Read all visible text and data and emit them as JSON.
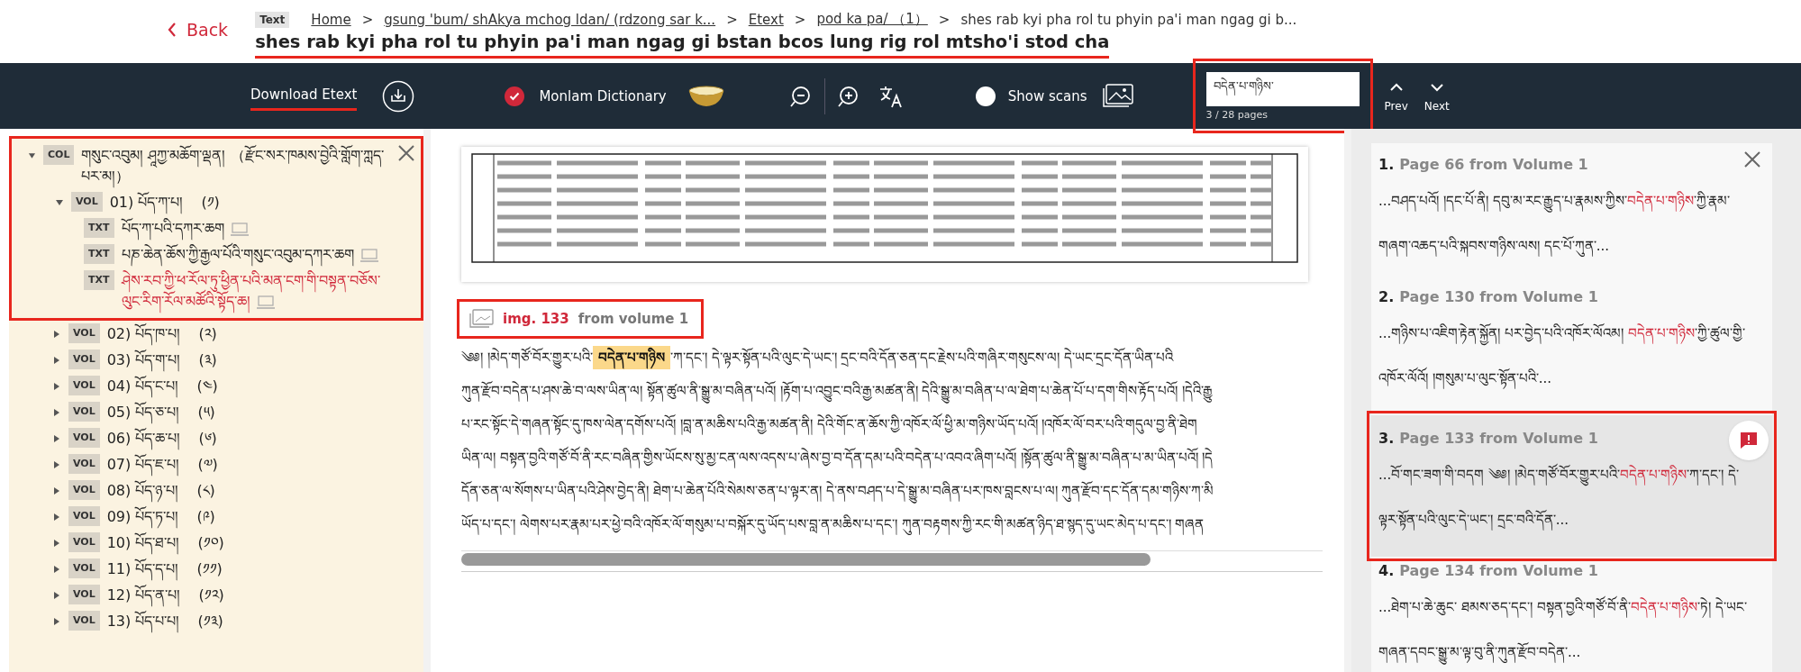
{
  "header": {
    "back": "Back",
    "type_badge": "Text",
    "breadcrumbs": [
      {
        "label": "Home",
        "link": true
      },
      {
        "separator": ">",
        "label": "gsung 'bum/ shAkya mchog ldan/ (rdzong sar k...",
        "link": true
      },
      {
        "separator": ">",
        "label": "Etext",
        "link": true
      },
      {
        "separator": ">",
        "label": "pod ka pa/ （1）",
        "link": true
      },
      {
        "separator": ">",
        "label": "shes rab kyi pha rol tu phyin pa'i man ngag gi b...",
        "link": false
      }
    ],
    "title": "shes rab kyi pha rol tu phyin pa'i man ngag gi bstan bcos lung rig rol mtsho'i stod cha",
    "highlighted": true
  },
  "toolbar": {
    "download": {
      "label": "Download Etext",
      "highlighted": true
    },
    "dictionary": {
      "label": "Monlam Dictionary",
      "checked": true
    },
    "scans": {
      "label": "Show scans",
      "on": false
    },
    "search": {
      "value": "བདེན་པ་གཉིས་",
      "count": "3 / 28 pages",
      "highlighted": true
    },
    "prev": "Prev",
    "next": "Next"
  },
  "tree": {
    "tag": "COL",
    "label": "གསུང་འབུམ། ཤཱཀྱ་མཆོག་ལྡན། （རྫོང་སར་ཁམས་བྱེའི་གློག་ཀླད་པར་མ།）",
    "expanded": true,
    "highlighted": true,
    "children": [
      {
        "tag": "VOL",
        "label": "01) པོད་ཀ་པ།",
        "number": "(༡)",
        "expanded": true,
        "children": [
          {
            "tag": "TXT",
            "label": "པོད་ཀ་པའི་དཀར་ཆག",
            "selected": false
          },
          {
            "tag": "TXT",
            "label": "པཎ་ཆེན་ཆོས་ཀྱི་རྒྱལ་པོའི་གསུང་འབུམ་དཀར་ཆག",
            "selected": false
          },
          {
            "tag": "TXT",
            "label": "ཤེས་རབ་ཀྱི་ཕ་རོལ་ཏུ་ཕྱིན་པའི་མན་ངག་གི་བསྟན་བཅོས་ལུང་རིག་རོལ་མཚོའི་སྟོད་ཆ།",
            "selected": true
          }
        ]
      },
      {
        "tag": "VOL",
        "label": "02) པོད་ཁ་པ།",
        "number": "(༢)",
        "expanded": false
      },
      {
        "tag": "VOL",
        "label": "03) པོད་ག་པ།",
        "number": "(༣)",
        "expanded": false
      },
      {
        "tag": "VOL",
        "label": "04) པོད་ང་པ།",
        "number": "(༤)",
        "expanded": false
      },
      {
        "tag": "VOL",
        "label": "05) པོད་ཅ་པ།",
        "number": "(༥)",
        "expanded": false
      },
      {
        "tag": "VOL",
        "label": "06) པོད་ཆ་པ།",
        "number": "(༦)",
        "expanded": false
      },
      {
        "tag": "VOL",
        "label": "07) པོད་ཇ་པ།",
        "number": "(༧)",
        "expanded": false
      },
      {
        "tag": "VOL",
        "label": "08) པོད་ཉ་པ།",
        "number": "(༨)",
        "expanded": false
      },
      {
        "tag": "VOL",
        "label": "09) པོད་ཏ་པ།",
        "number": "(༩)",
        "expanded": false
      },
      {
        "tag": "VOL",
        "label": "10) པོད་ཐ་པ།",
        "number": "(༡༠)",
        "expanded": false
      },
      {
        "tag": "VOL",
        "label": "11) པོད་ད་པ།",
        "number": "(༡༡)",
        "expanded": false
      },
      {
        "tag": "VOL",
        "label": "12) པོད་ན་པ།",
        "number": "(༡༢)",
        "expanded": false
      },
      {
        "tag": "VOL",
        "label": "13) པོད་པ་པ།",
        "number": "(༡༣)",
        "expanded": false
      }
    ]
  },
  "reader": {
    "caption": {
      "image": "img. 133",
      "volume": "from volume 1",
      "highlighted": true
    },
    "lines": [
      {
        "before": "༄༅། །མེད་གཙོ་བོར་གྱུར་པའི་",
        "match": "བདེན་པ་གཉིས",
        "after": "་ཀ་དང་། དེ་ལྟར་སྟོན་པའི་ལུང་དེ་ཡང་། དྲང་བའི་དོན་ཅན་དང་རྗེས་པའི་གཞིར་གསུངས་ལ། དེ་ཡང་དྲང་དོན་ཡིན་པའི"
      },
      {
        "before": "ཀུན་རྫོབ་བདེན་པ་ཤས་ཆེ་བ་ལས་ཡིན་ལ། སྟོན་ཚུལ་ནི་སྒྱུ་མ་བཞིན་པའོ། །རྟོག་པ་འབྱུང་བའི་རྒྱ་མཚན་ནི། དེའི་སྒྱུ་མ་བཞིན་པ་ལ་ཐེག་པ་ཆེན་པོ་པ་དག་གིས་རྟོད་པའོ། །དེའི་རྒྱུ"
      },
      {
        "before": "པ་རང་སྟོང་དེ་གཞན་སྟོང་དུ་ཁས་ལེན་དགོས་པའོ། །བླ་ན་མཆིས་པའི་རྒྱ་མཚན་ནི། དེའི་གོང་ན་ཆོས་ཀྱི་འཁོར་ལོ་ཕྱི་མ་གཉིས་ཡོད་པའོ། །འཁོར་ལོ་བར་པའི་གདུལ་བྱ་ནི་ཐེག"
      },
      {
        "before": "ཡིན་ལ། བསྟན་བྱའི་གཙོ་བོ་ནི་རང་བཞིན་གྱིས་ཡོངས་སུ་མྱ་ངན་ལས་འདས་པ་ཞེས་བྱ་བ་དོན་དམ་པའི་བདེན་པ་འབའ་ཞིག་པའོ། །སྟོན་ཚུལ་ནི་སྒྱུ་མ་བཞིན་པ་མ་ཡིན་པའོ། །དེ"
      },
      {
        "before": "དོན་ཅན་ལ་སོགས་པ་ཡིན་པའི་ཤེས་བྱེད་ནི། ཐེག་པ་ཆེན་པོའི་སེམས་ཅན་པ་ལྟར་ན། དེ་ནས་བཤད་པ་དེ་སྒྱུ་མ་བཞིན་པར་ཁས་བླངས་པ་ལ། ཀུན་རྫོབ་དང་དོན་དམ་གཉིས་ཀ་མི"
      },
      {
        "before": "ཡོད་པ་དང་། ལེགས་པར་རྣམ་པར་ཕྱེ་བའི་འཁོར་ལོ་གསུམ་པ་བསྐོར་དུ་ཡོད་པས་བླ་ན་མཆིས་པ་དང་། ཀུན་བརྟགས་ཀྱི་རང་གི་མཚན་ཉིད་ཐ་སྙད་དུ་ཡང་མེད་པ་དང་། གཞན"
      }
    ]
  },
  "results": [
    {
      "number": "1.",
      "title": "Page 66 from Volume 1",
      "before": "...བཤད་པའོ། །དང་པོ་ནི། དབུ་མ་རང་རྒྱུད་པ་རྣམས་ཀྱིས་",
      "match": "བདེན་པ་གཉིས",
      "after": "་ཀྱི་རྣམ་གཞག་འཆད་པའི་སྐབས་གཉིས་ལས། དང་པོ་ཀུན་...",
      "selected": false
    },
    {
      "number": "2.",
      "title": "Page 130 from Volume 1",
      "before": "...གཉིས་པ་འཇིག་རྟེན་སྐྱོན། པར་བྱེད་པའི་འཁོར་ལོའམ། ",
      "match": "བདེན་པ་གཉིས",
      "after": "་ཀྱི་ཚུལ་གྱི་འཁོར་ལོའོ། །གསུམ་པ་ལུང་སྟོན་པའི་...",
      "selected": false
    },
    {
      "number": "3.",
      "title": "Page 133 from Volume 1",
      "before": "...བོ་གང་ཟག་གི་བདག ༄༅། །མེད་གཙོ་བོར་གྱུར་པའི་",
      "match": "བདེན་པ་གཉིས",
      "after": "་ཀ་དང་། དེ་ལྟར་སྟོན་པའི་ལུང་དེ་ཡང་། དྲང་བའི་དོན་...",
      "selected": true
    },
    {
      "number": "4.",
      "title": "Page 134 from Volume 1",
      "before": "...ཐེག་པ་ཆེ་ཆུང་ ཐམས་ཅད་དང་། བསྟན་བྱའི་གཙོ་བོ་ནི་",
      "match": "བདེན་པ་གཉིས",
      "after": "་ཏེ། དེ་ཡང་གཞན་དབང་སྒྱུ་མ་ལྟ་བུ་ནི་ཀུན་རྫོབ་བདེན་...",
      "selected": false
    }
  ]
}
